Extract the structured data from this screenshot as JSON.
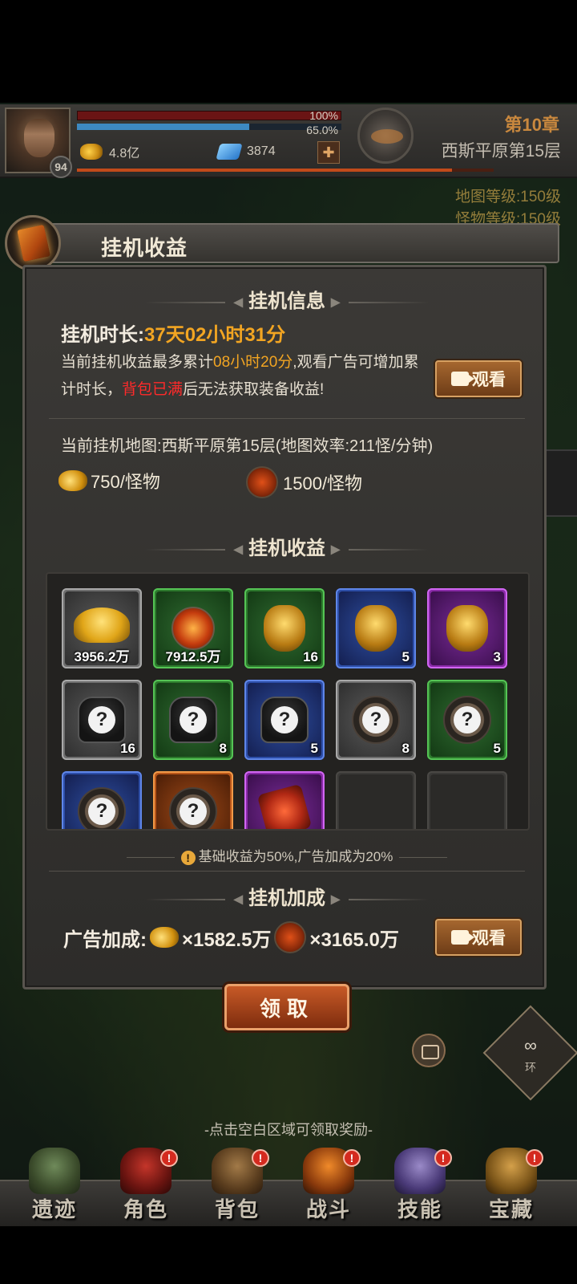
{
  "hud": {
    "level": "94",
    "hp_percent_label": "100%",
    "mp_percent_label": "65.0%",
    "mp_fill": 0.65,
    "gold_amount": "4.8亿",
    "gem_amount": "3874",
    "chapter": "第10章",
    "map_name": "西斯平原第15层"
  },
  "side_info": {
    "line1": "地图等级:150级",
    "line2": "怪物等级:150级"
  },
  "dialog": {
    "title": "挂机收益",
    "section_info": "挂机信息",
    "duration_label": "挂机时长:",
    "duration_value": "37天02小时31分",
    "desc_part1": "当前挂机收益最多累计",
    "desc_highlight_time": "08小时20分",
    "desc_part2": ",观看广告可增加累计时长，",
    "desc_highlight_full": "背包已满",
    "desc_part3": "后无法获取装备收益!",
    "watch_label": "观看",
    "map_line": "当前挂机地图:西斯平原第15层(地图效率:211怪/分钟)",
    "gold_rate": "750/怪物",
    "exp_rate": "1500/怪物",
    "section_rewards": "挂机收益",
    "tip": "基础收益为50%,广告加成为20%",
    "section_bonus": "挂机加成",
    "ad_bonus_label": "广告加成:",
    "ad_gold": "×1582.5万",
    "ad_exp": "×3165.0万",
    "claim_label": "领取"
  },
  "rewards": [
    {
      "quality": "gray",
      "kind": "gold-pile",
      "count": "3956.2万"
    },
    {
      "quality": "green",
      "kind": "exp-orb",
      "count": "7912.5万"
    },
    {
      "quality": "green",
      "kind": "bag",
      "count": "16"
    },
    {
      "quality": "blue",
      "kind": "bag",
      "count": "5"
    },
    {
      "quality": "purple",
      "kind": "bag",
      "count": "3"
    },
    {
      "quality": "gray",
      "kind": "armor",
      "count": "16"
    },
    {
      "quality": "green",
      "kind": "armor",
      "count": "8"
    },
    {
      "quality": "blue",
      "kind": "armor",
      "count": "5"
    },
    {
      "quality": "gray",
      "kind": "ring",
      "count": "8"
    },
    {
      "quality": "green",
      "kind": "ring",
      "count": "5"
    },
    {
      "quality": "blue",
      "kind": "ring",
      "count": ""
    },
    {
      "quality": "orange",
      "kind": "ring",
      "count": ""
    },
    {
      "quality": "purple",
      "kind": "scroll",
      "count": ""
    },
    {
      "quality": "empty",
      "kind": "",
      "count": ""
    },
    {
      "quality": "empty",
      "kind": "",
      "count": ""
    }
  ],
  "side_controls": {
    "loop_symbol": "∞",
    "loop_label": "环"
  },
  "hint": "-点击空白区域可领取奖励-",
  "nav": [
    {
      "label": "遗迹",
      "badge": ""
    },
    {
      "label": "角色",
      "badge": "!"
    },
    {
      "label": "背包",
      "badge": "!"
    },
    {
      "label": "战斗",
      "badge": "!"
    },
    {
      "label": "技能",
      "badge": "!"
    },
    {
      "label": "宝藏",
      "badge": "!"
    }
  ]
}
